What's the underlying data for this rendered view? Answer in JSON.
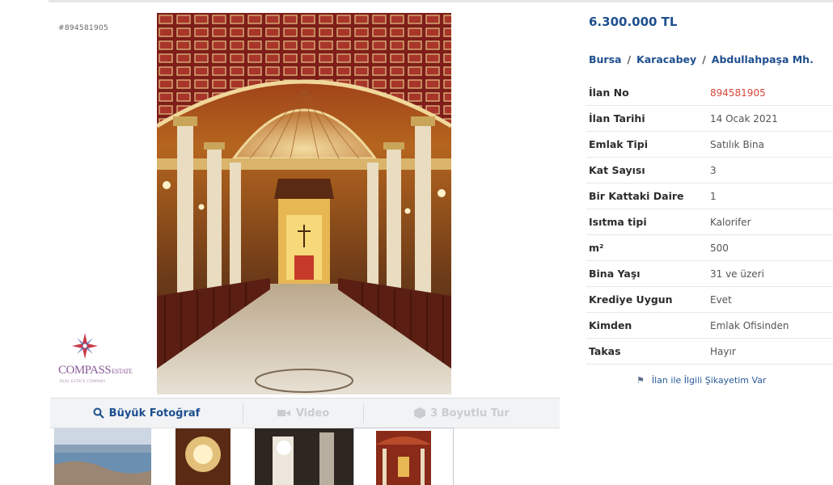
{
  "listing_id_small": "#894581905",
  "logo": {
    "brand": "COMPASS",
    "sub": "ESTATE",
    "tagline": "REAL ESTATE COMPANY"
  },
  "toolbar": {
    "big_photo": "Büyük Fotoğraf",
    "video": "Video",
    "tour": "3 Boyutlu Tur",
    "icons": [
      "search-icon",
      "video-camera-icon",
      "cube-icon"
    ]
  },
  "price": "6.300.000 TL",
  "breadcrumb": [
    "Bursa",
    "Karacabey",
    "Abdullahpaşa Mh."
  ],
  "details": [
    {
      "key": "İlan No",
      "value": "894581905",
      "highlight": true
    },
    {
      "key": "İlan Tarihi",
      "value": "14 Ocak 2021"
    },
    {
      "key": "Emlak Tipi",
      "value": "Satılık Bina"
    },
    {
      "key": "Kat Sayısı",
      "value": "3"
    },
    {
      "key": "Bir Kattaki Daire",
      "value": "1"
    },
    {
      "key": "Isıtma tipi",
      "value": "Kalorifer"
    },
    {
      "key": "m²",
      "value": "500"
    },
    {
      "key": "Bina Yaşı",
      "value": "31 ve üzeri"
    },
    {
      "key": "Krediye Uygun",
      "value": "Evet"
    },
    {
      "key": "Kimden",
      "value": "Emlak Ofisinden"
    },
    {
      "key": "Takas",
      "value": "Hayır"
    }
  ],
  "complaint_link": "İlan ile İlgili Şikayetim Var",
  "colors": {
    "link_blue": "#1f4f8f",
    "id_red": "#d9463a",
    "toolbar_bg": "#f2f3f5"
  }
}
